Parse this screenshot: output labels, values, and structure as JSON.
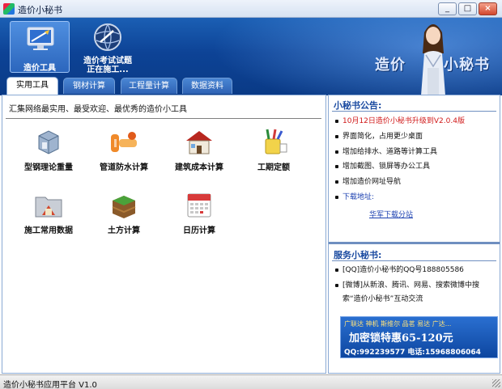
{
  "window": {
    "title": "造价小秘书",
    "buttons": {
      "minimize": "_",
      "maximize": "□",
      "close": "×"
    }
  },
  "header": {
    "tools": [
      {
        "label": "造价工具",
        "icon": "monitor-icon"
      },
      {
        "label_line1": "造价考试试题",
        "label_line2": "正在施工...",
        "icon": "globe-icon"
      }
    ],
    "brand_left": "造价",
    "brand_right": "小秘书"
  },
  "tabs": [
    "实用工具",
    "钢材计算",
    "工程量计算",
    "数据资料"
  ],
  "main": {
    "tagline": "汇集网络最实用、最受欢迎、最优秀的造价小工具",
    "tools": [
      {
        "label": "型钢理论重量",
        "icon": "steel-box-icon"
      },
      {
        "label": "管道防水计算",
        "icon": "pipe-icon"
      },
      {
        "label": "建筑成本计算",
        "icon": "house-icon"
      },
      {
        "label": "工期定额",
        "icon": "pencil-cup-icon"
      },
      {
        "label": "施工常用数据",
        "icon": "folder-icon"
      },
      {
        "label": "土方计算",
        "icon": "soil-icon"
      },
      {
        "label": "日历计算",
        "icon": "calendar-icon"
      }
    ]
  },
  "announcement": {
    "title": "小秘书公告:",
    "items": [
      "10月12日造价小秘书升级到V2.0.4版",
      "界面简化，占用更少桌面",
      "增加给排水、道路等计算工具",
      "增加截图、锁屏等办公工具",
      "增加造价网址导航",
      "下载地址:"
    ],
    "link": "华军下载分站"
  },
  "service": {
    "title": "服务小秘书:",
    "items": [
      "[QQ]造价小秘书的QQ号188805586",
      "[微博]从新浪、腾讯、网易、搜索微博中搜",
      "索“造价小秘书”互动交流"
    ]
  },
  "ad": {
    "line1": "广联达 神机 斯维尔 品茗 易达 广达...",
    "line2": "加密锁特惠65-120元",
    "line3": "QQ:992239577  电话:15968806064"
  },
  "status": {
    "text": "造价小秘书应用平台 V1.0"
  },
  "colors": {
    "banner": "#0d4396",
    "accent_red": "#d01818",
    "link_blue": "#1a3fb0"
  }
}
